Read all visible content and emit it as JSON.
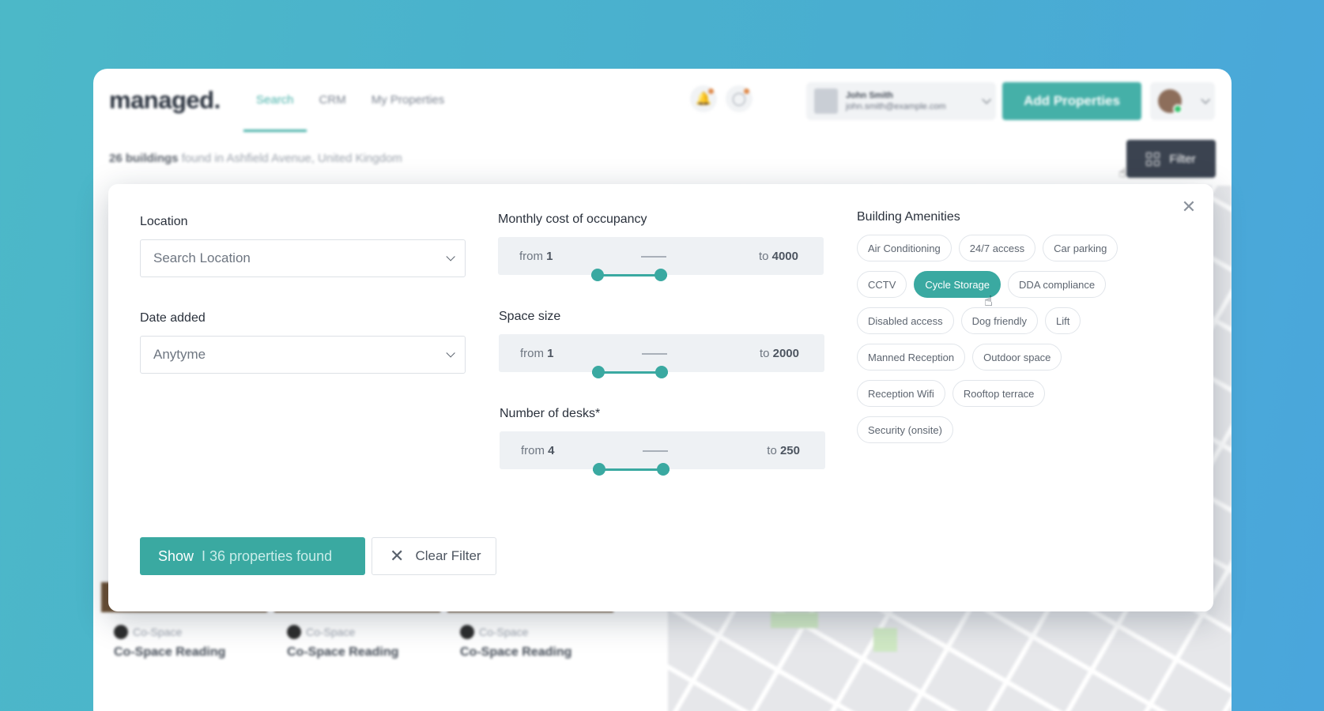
{
  "app": {
    "logo": "managed.",
    "nav": [
      {
        "label": "Search",
        "active": true
      },
      {
        "label": "CRM",
        "active": false
      },
      {
        "label": "My Properties",
        "active": false
      }
    ],
    "user": {
      "name": "John Smith",
      "email": "john.smith@example.com"
    },
    "add_button": "Add Properties",
    "results": {
      "count": "26 buildings",
      "suffix": "found in Ashfield Avenue, United Kingdom"
    },
    "filter_button": "Filter",
    "cards": [
      {
        "type": "Co-Space",
        "name": "Co-Space Reading"
      },
      {
        "type": "Co-Space",
        "name": "Co-Space Reading"
      },
      {
        "type": "Co-Space",
        "name": "Co-Space Reading"
      }
    ],
    "colors": {
      "accent": "#3aa9a1",
      "dark_button": "#3b4350",
      "notification_dot": "#e08a4a"
    }
  },
  "filter": {
    "location": {
      "label": "Location",
      "placeholder": "Search Location"
    },
    "date_added": {
      "label": "Date added",
      "value": "Anytyme"
    },
    "monthly_cost": {
      "label": "Monthly cost of occupancy",
      "from_prefix": "from",
      "from": "1",
      "to_prefix": "to",
      "to": "4000"
    },
    "space_size": {
      "label": "Space size",
      "from_prefix": "from",
      "from": "1",
      "to_prefix": "to",
      "to": "2000"
    },
    "desks": {
      "label": "Number of desks*",
      "from_prefix": "from",
      "from": "4",
      "to_prefix": "to",
      "to": "250"
    },
    "amenities": {
      "label": "Building Amenities",
      "items": [
        {
          "label": "Air Conditioning",
          "selected": false
        },
        {
          "label": "24/7 access",
          "selected": false
        },
        {
          "label": "Car parking",
          "selected": false
        },
        {
          "label": "CCTV",
          "selected": false
        },
        {
          "label": "Cycle Storage",
          "selected": true
        },
        {
          "label": "DDA compliance",
          "selected": false
        },
        {
          "label": "Disabled access",
          "selected": false
        },
        {
          "label": "Dog friendly",
          "selected": false
        },
        {
          "label": "Lift",
          "selected": false
        },
        {
          "label": "Manned Reception",
          "selected": false
        },
        {
          "label": "Outdoor space",
          "selected": false
        },
        {
          "label": "Reception Wifi",
          "selected": false
        },
        {
          "label": "Rooftop terrace",
          "selected": false
        },
        {
          "label": "Security (onsite)",
          "selected": false
        }
      ]
    },
    "show_button": {
      "label": "Show",
      "count": "I 36 properties found"
    },
    "clear_button": {
      "label": "Clear Filter"
    },
    "close_icon": "close-icon"
  }
}
